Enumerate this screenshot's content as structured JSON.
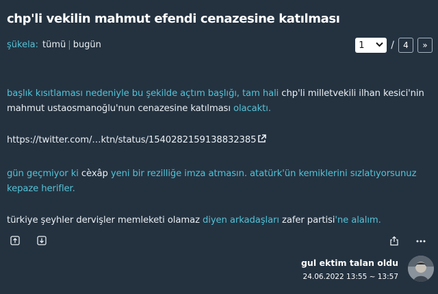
{
  "topic": {
    "title": "chp'li vekilin mahmut efendi cenazesine katılması"
  },
  "filters": {
    "sukela_label": "şükela:",
    "all_label": "tümü",
    "today_label": "bugün",
    "separator": "|"
  },
  "pager": {
    "current_page": "1",
    "slash": "/",
    "total_pages": "4",
    "next_label": "»"
  },
  "entry": {
    "p1": {
      "s1": "başlık kısıtlaması nedeniyle bu şekilde açtım başlığı, tam hali",
      "s2": " chp'li milletvekili ilhan kesici'nin mahmut ustaosmanoğlu'nun cenazesine katılması ",
      "s3": "olacaktı."
    },
    "url_text": "https://twitter.com/…ktn/status/1540282159138832385",
    "p3": {
      "s1": "gün geçmiyor ki",
      "s2": " cèxâp ",
      "s3": "yeni bir rezilliğe imza atmasın. atatürk'ün kemiklerini sızlatıyorsunuz kepaze herifler."
    },
    "p4": {
      "s1": "türkiye şeyhler dervişler memleketi olamaz ",
      "s2": "diyen arkadaşları",
      "s3": " zafer partisi",
      "s4": "'ne alalım."
    },
    "author": "gul ektim talan oldu",
    "date": "24.06.2022 13:55 ~ 13:57"
  },
  "icons": {
    "upvote": "arrow-up-box-icon",
    "downvote": "arrow-down-box-icon",
    "share": "share-icon",
    "more": "ellipsis-icon",
    "external_link": "external-link-icon"
  },
  "colors": {
    "background": "#243240",
    "link": "#53c2d6",
    "text": "#e9eef2"
  }
}
